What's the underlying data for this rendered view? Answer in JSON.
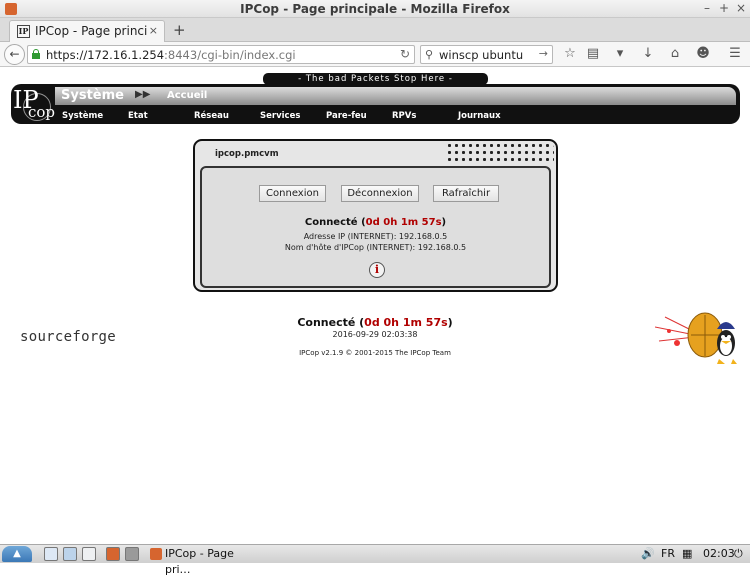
{
  "window": {
    "title": "IPCop - Page principale - Mozilla Firefox",
    "minimize": "–",
    "maximize": "+",
    "close": "×"
  },
  "tabs": [
    {
      "label": "IPCop - Page princip…",
      "favicon": "IP",
      "close": "×"
    }
  ],
  "new_tab": "+",
  "navbar": {
    "url_host": "https://172.16.1.254",
    "url_rest": ":8443/cgi-bin/index.cgi",
    "search_value": "winscp ubuntu",
    "icons": [
      "bookmark-star-icon",
      "reading-list-icon",
      "pocket-icon",
      "download-icon",
      "home-icon",
      "chat-icon",
      "menu-icon"
    ]
  },
  "ipcop": {
    "slogan": "- The bad Packets Stop Here -",
    "logo_ip": "IP",
    "logo_cop": "cop",
    "section": "Système",
    "arrows": "▶▶",
    "current_page": "Accueil",
    "menu": [
      "Système",
      "Etat",
      "Réseau",
      "Services",
      "Pare-feu",
      "RPVs",
      "Journaux"
    ]
  },
  "panel": {
    "title": "ipcop.pmcvm",
    "buttons": {
      "connect": "Connexion",
      "disconnect": "Déconnexion",
      "refresh": "Rafraîchir"
    },
    "status_label": "Connecté",
    "status_time": "0d 0h 1m 57s",
    "ip_line": "Adresse IP (INTERNET): 192.168.0.5",
    "host_line": "Nom d'hôte d'IPCop (INTERNET): 192.168.0.5",
    "info_glyph": "i"
  },
  "footer": {
    "sourceforge": "sourceforge",
    "status_label": "Connecté",
    "status_time": "0d 0h 1m 57s",
    "datetime": "2016-09-29 02:03:38",
    "copyright": "IPCop v2.1.9 © 2001-2015 The IPCop Team"
  },
  "taskbar": {
    "task_label": "IPCop - Page pri…",
    "language": "FR",
    "clock": "02:03"
  },
  "colors": {
    "accent_red": "#b00000",
    "header_black": "#111111",
    "panel_grey": "#e6e6e6"
  }
}
